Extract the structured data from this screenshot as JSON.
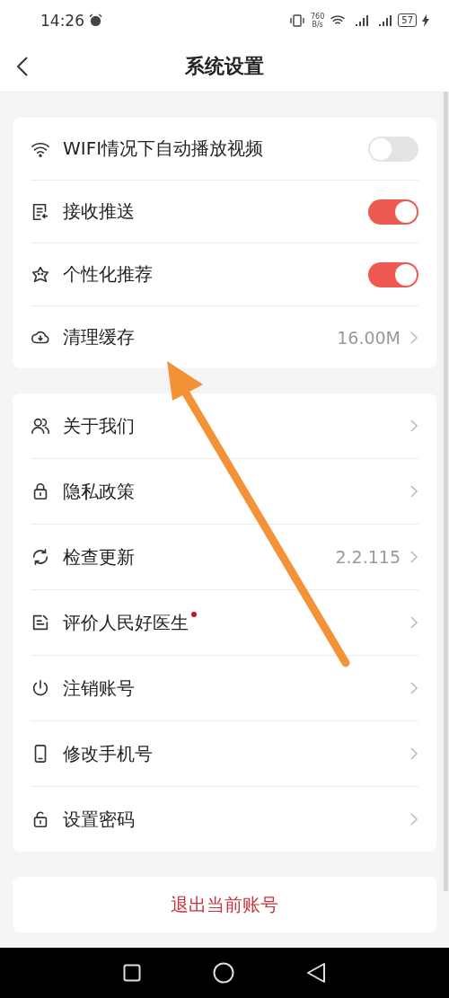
{
  "status_bar": {
    "time": "14:26",
    "speed_value": "760",
    "speed_unit": "B/s",
    "battery": "57"
  },
  "header": {
    "title": "系统设置"
  },
  "group_1": [
    {
      "kind": "toggle",
      "label": "WIFI情况下自动播放视频",
      "on": false
    },
    {
      "kind": "toggle",
      "label": "接收推送",
      "on": true
    },
    {
      "kind": "toggle",
      "label": "个性化推荐",
      "on": true
    },
    {
      "kind": "link",
      "label": "清理缓存",
      "value": "16.00M"
    }
  ],
  "group_2": [
    {
      "kind": "link",
      "label": "关于我们"
    },
    {
      "kind": "link",
      "label": "隐私政策"
    },
    {
      "kind": "link",
      "label": "检查更新",
      "value": "2.2.115"
    },
    {
      "kind": "link",
      "label": "评价人民好医生",
      "dot": true
    },
    {
      "kind": "link",
      "label": "注销账号"
    },
    {
      "kind": "link",
      "label": "修改手机号"
    },
    {
      "kind": "link",
      "label": "设置密码"
    }
  ],
  "logout_button": "退出当前账号"
}
